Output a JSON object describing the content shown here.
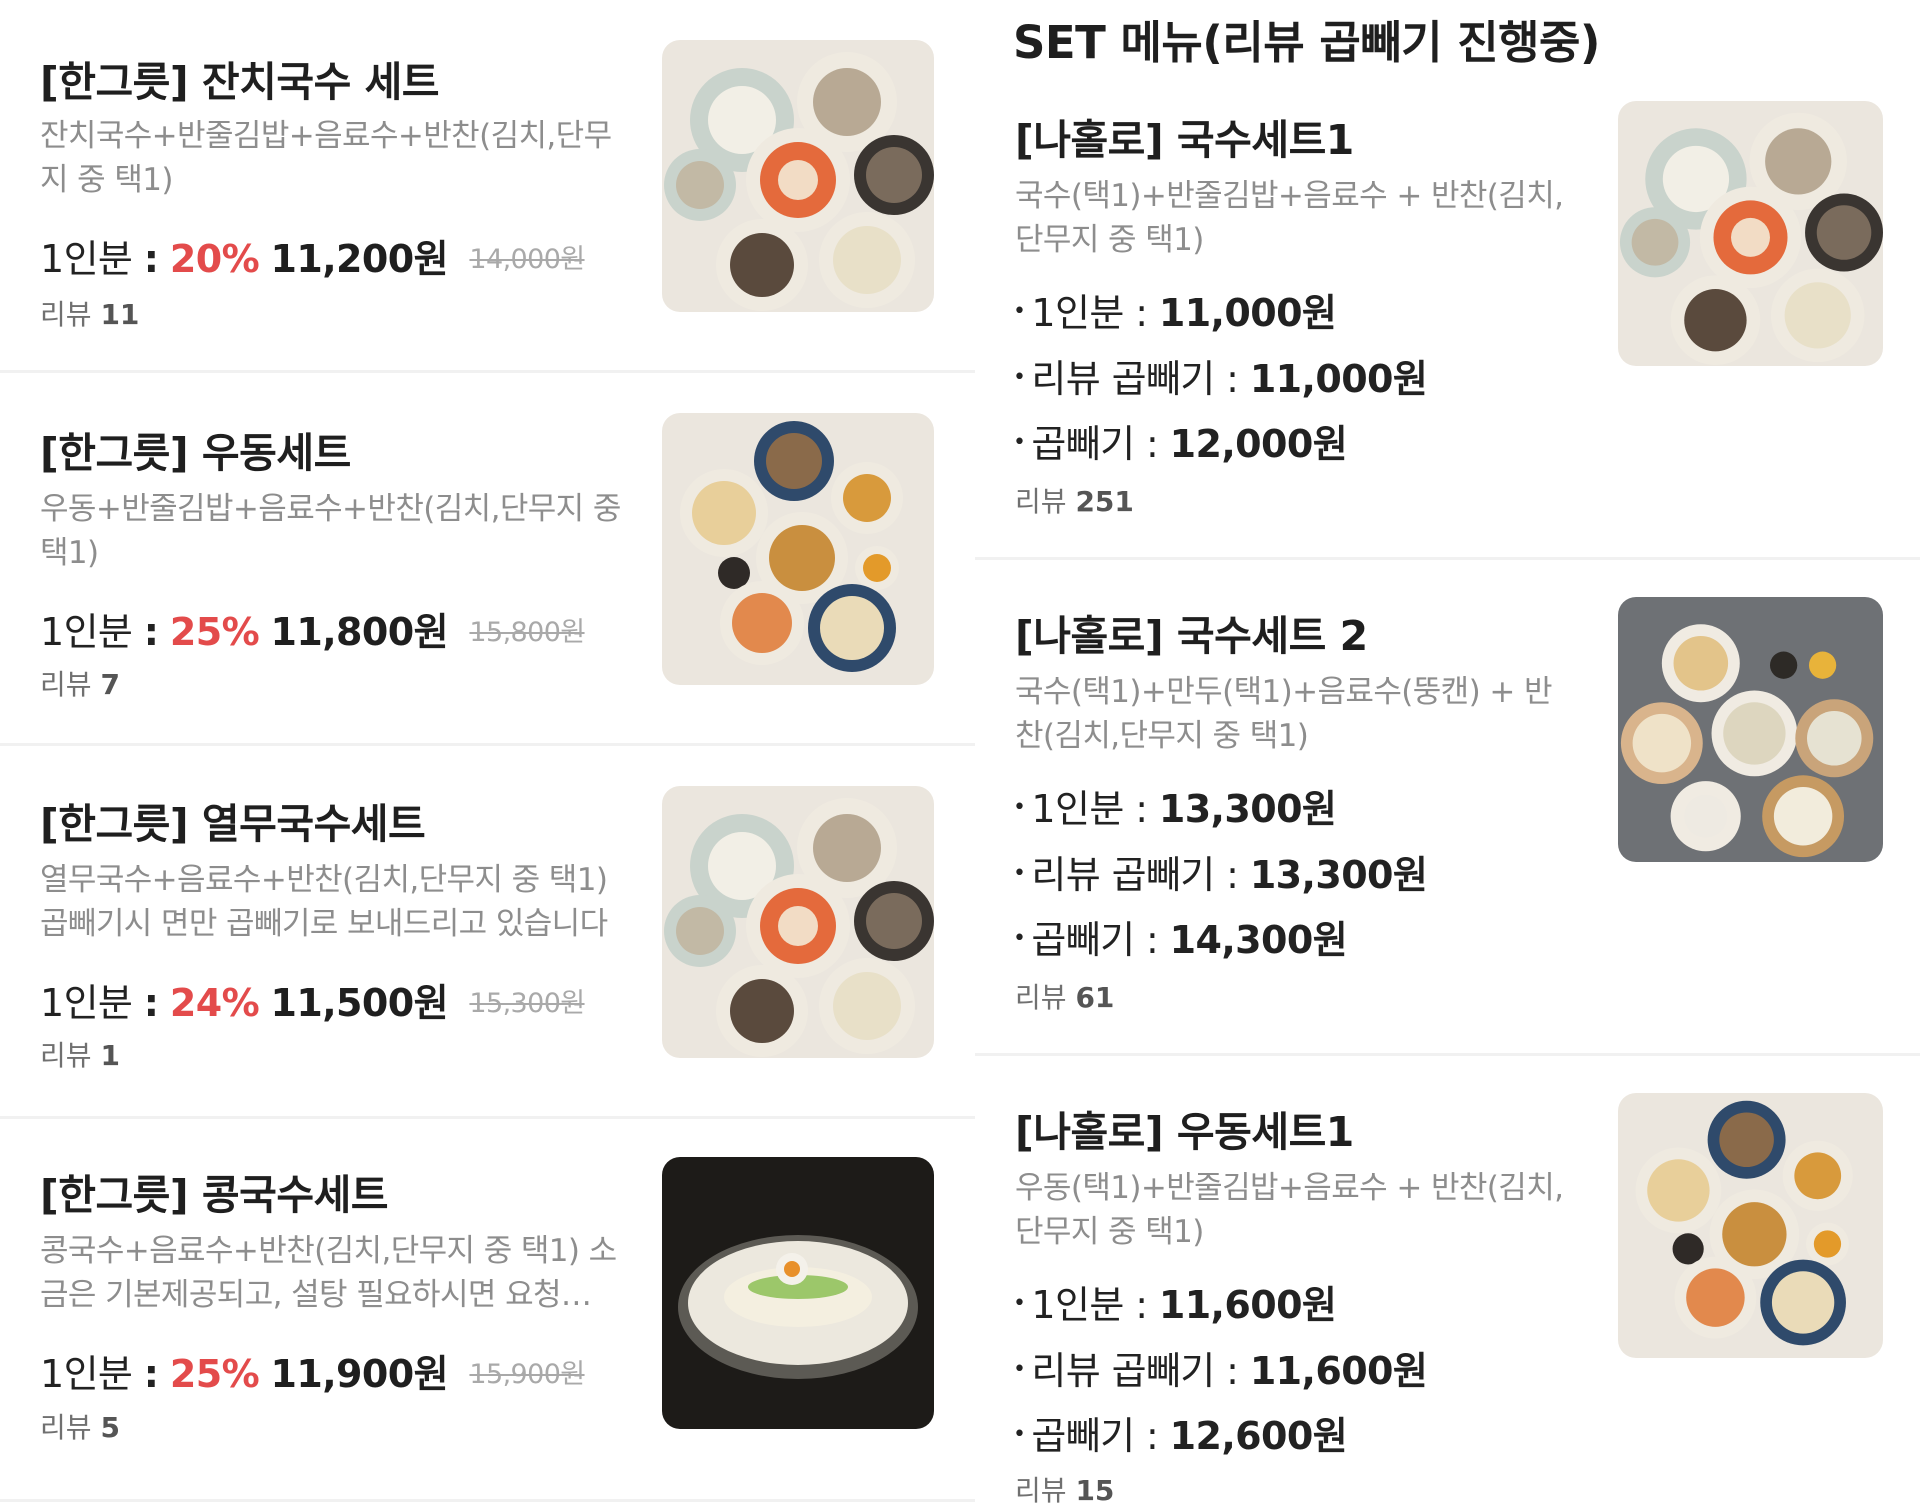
{
  "left_items": [
    {
      "title": "[한그릇] 잔치국수 세트",
      "desc": "잔치국수+반줄김밥+음료수+반찬(김치,단무지 중 택1)",
      "serving": "1인분",
      "discount": "20%",
      "price": "11,200원",
      "original": "14,000원",
      "review_label": "리뷰",
      "review_count": "11"
    },
    {
      "title": "[한그릇] 우동세트",
      "desc": "우동+반줄김밥+음료수+반찬(김치,단무지 중 택1)",
      "serving": "1인분",
      "discount": "25%",
      "price": "11,800원",
      "original": "15,800원",
      "review_label": "리뷰",
      "review_count": "7"
    },
    {
      "title": "[한그릇] 열무국수세트",
      "desc": "열무국수+음료수+반찬(김치,단무지 중 택1)\n곱빼기시 면만 곱빼기로 보내드리고 있습니다",
      "serving": "1인분",
      "discount": "24%",
      "price": "11,500원",
      "original": "15,300원",
      "review_label": "리뷰",
      "review_count": "1"
    },
    {
      "title": "[한그릇] 콩국수세트",
      "desc": "콩국수+음료수+반찬(김치,단무지 중 택1) 소금은 기본제공되고, 설탕 필요하시면 요청…",
      "serving": "1인분",
      "discount": "25%",
      "price": "11,900원",
      "original": "15,900원",
      "review_label": "리뷰",
      "review_count": "5"
    }
  ],
  "right_section_title": "SET 메뉴(리뷰 곱빼기 진행중)",
  "right_items": [
    {
      "title": "[나홀로] 국수세트1",
      "desc": "국수(택1)+반줄김밥+음료수 + 반찬(김치,단무지 중 택1)",
      "prices": [
        {
          "label": "1인분",
          "value": "11,000원"
        },
        {
          "label": "리뷰 곱빼기",
          "value": "11,000원"
        },
        {
          "label": "곱빼기",
          "value": "12,000원"
        }
      ],
      "review_label": "리뷰",
      "review_count": "251"
    },
    {
      "title": "[나홀로] 국수세트 2",
      "desc": "국수(택1)+만두(택1)+음료수(뚱캔) + 반찬(김치,단무지 중 택1)",
      "prices": [
        {
          "label": "1인분",
          "value": "13,300원"
        },
        {
          "label": "리뷰 곱빼기",
          "value": "13,300원"
        },
        {
          "label": "곱빼기",
          "value": "14,300원"
        }
      ],
      "review_label": "리뷰",
      "review_count": "61"
    },
    {
      "title": "[나홀로] 우동세트1",
      "desc": "우동(택1)+반줄김밥+음료수 + 반찬(김치,단무지 중 택1)",
      "prices": [
        {
          "label": "1인분",
          "value": "11,600원"
        },
        {
          "label": "리뷰 곱빼기",
          "value": "11,600원"
        },
        {
          "label": "곱빼기",
          "value": "12,600원"
        }
      ],
      "review_label": "리뷰",
      "review_count": "15"
    }
  ],
  "colors": {
    "discount_red": "#e34b4b",
    "title_black": "#1f1f1f",
    "desc_gray": "#8d8d8d",
    "strike_gray": "#a9a9a9"
  },
  "price_separator": ":",
  "bullet_glyph": "•"
}
